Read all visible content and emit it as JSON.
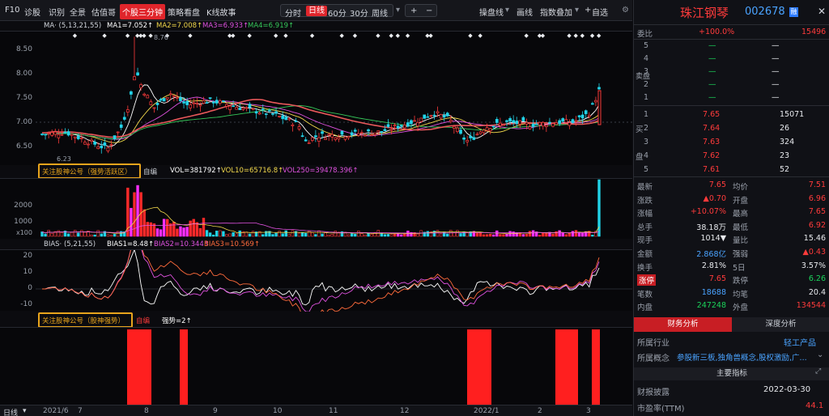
{
  "toolbar": {
    "f10": "F10",
    "diag": "诊股",
    "ident": "识别",
    "all": "全景",
    "estimate": "估值哥",
    "active_tab": "个股三分钟",
    "strategy": "策略看盘",
    "kline_story": "K线故事",
    "periods": [
      "分时",
      "日线",
      "60分",
      "30分",
      "周线"
    ],
    "plus": "+",
    "minus": "−",
    "tools": [
      "操盘线",
      "画线",
      "指数叠加",
      "自选"
    ],
    "settings_icon": "gear-icon"
  },
  "main_chart": {
    "caption": "MA· (5,13,21,55)",
    "ma1": "MA1=7.052↑",
    "ma2": "MA2=7.008↑",
    "ma3": "MA3=6.933↑",
    "ma4": "MA4=6.919↑",
    "y_ticks": [
      "8.50",
      "8.00",
      "7.50",
      "7.00",
      "6.50"
    ],
    "high_label": "8.76",
    "low_label": "6.23"
  },
  "vol_pane": {
    "indicator_name": "关注股神公号（强势活跃区）",
    "mode": "自编",
    "vol": "VOL=381792↑",
    "vol10": "VOL10=65716.8↑",
    "vol250": "VOL250=39478.396↑",
    "y_ticks": [
      "2000",
      "1000"
    ],
    "unit": "x100"
  },
  "bias_pane": {
    "caption": "BIAS· (5,21,55)",
    "bias1": "BIAS1=8.48↑",
    "bias2": "BIAS2=10.344↑",
    "bias3": "BIAS3=10.569↑",
    "y_ticks": [
      "20",
      "10",
      "0",
      "-10"
    ]
  },
  "signal_pane": {
    "indicator_name": "关注股神公号（股神强势）",
    "mode": "自编",
    "value": "强势=2↑"
  },
  "xaxis": {
    "mode_label": "日线",
    "dates": [
      "2021/6",
      "7",
      "8",
      "9",
      "10",
      "11",
      "12",
      "2022/1",
      "2",
      "3"
    ]
  },
  "quote": {
    "name": "珠江钢琴",
    "code": "002678",
    "weibi_label": "委比",
    "weibi": "+100.0%",
    "weicha": "15496",
    "sell_label": "卖盘",
    "sells": [
      {
        "lvl": "5",
        "price": "—",
        "vol": "—"
      },
      {
        "lvl": "4",
        "price": "—",
        "vol": "—"
      },
      {
        "lvl": "3",
        "price": "—",
        "vol": "—"
      },
      {
        "lvl": "2",
        "price": "—",
        "vol": "—"
      },
      {
        "lvl": "1",
        "price": "—",
        "vol": "—"
      }
    ],
    "buy_label": "买盘",
    "buys": [
      {
        "lvl": "1",
        "price": "7.65",
        "vol": "15071"
      },
      {
        "lvl": "2",
        "price": "7.64",
        "vol": "26"
      },
      {
        "lvl": "3",
        "price": "7.63",
        "vol": "324"
      },
      {
        "lvl": "4",
        "price": "7.62",
        "vol": "23"
      },
      {
        "lvl": "5",
        "price": "7.61",
        "vol": "52"
      }
    ],
    "stats": [
      {
        "l1": "最新",
        "v1": "7.65",
        "c1": "red",
        "l2": "均价",
        "v2": "7.51",
        "c2": "red"
      },
      {
        "l1": "涨跌",
        "v1": "▲0.70",
        "c1": "red",
        "l2": "开盘",
        "v2": "6.96",
        "c2": "red"
      },
      {
        "l1": "涨幅",
        "v1": "+10.07%",
        "c1": "red",
        "l2": "最高",
        "v2": "7.65",
        "c2": "red"
      },
      {
        "l1": "总手",
        "v1": "38.18万",
        "c1": "white",
        "l2": "最低",
        "v2": "6.92",
        "c2": "red"
      },
      {
        "l1": "现手",
        "v1": "1014▼",
        "c1": "white",
        "l2": "量比",
        "v2": "15.46",
        "c2": "white"
      },
      {
        "l1": "金额",
        "v1": "2.868亿",
        "c1": "blue",
        "l2": "强弱",
        "v2": "▲0.43",
        "c2": "red"
      },
      {
        "l1": "换手",
        "v1": "2.81%",
        "c1": "white",
        "l2": "5日",
        "v2": "3.57%",
        "c2": "white"
      },
      {
        "l1": "涨停",
        "v1": "7.65",
        "c1": "red",
        "l2": "跌停",
        "v2": "6.26",
        "c2": "green"
      },
      {
        "l1": "笔数",
        "v1": "18688",
        "c1": "blue",
        "l2": "均笔",
        "v2": "20.4",
        "c2": "white"
      },
      {
        "l1": "内盘",
        "v1": "247248",
        "c1": "green",
        "l2": "外盘",
        "v2": "134544",
        "c2": "red"
      }
    ],
    "tab_fin": "财务分析",
    "tab_depth": "深度分析",
    "industry_label": "所属行业",
    "industry": "轻工产品",
    "concept_label": "所属概念",
    "concept": "参股新三板,独角兽概念,股权激励,广...",
    "indicator_title": "主要指标",
    "report_label": "财报披露",
    "report_date": "2022-03-30",
    "pe_label": "市盈率(TTM)",
    "pe": "44.1"
  },
  "colors": {
    "up": "#ff3b3b",
    "down": "#1bd35a",
    "accent": "#e0252b",
    "highlight": "#e8a41c"
  }
}
